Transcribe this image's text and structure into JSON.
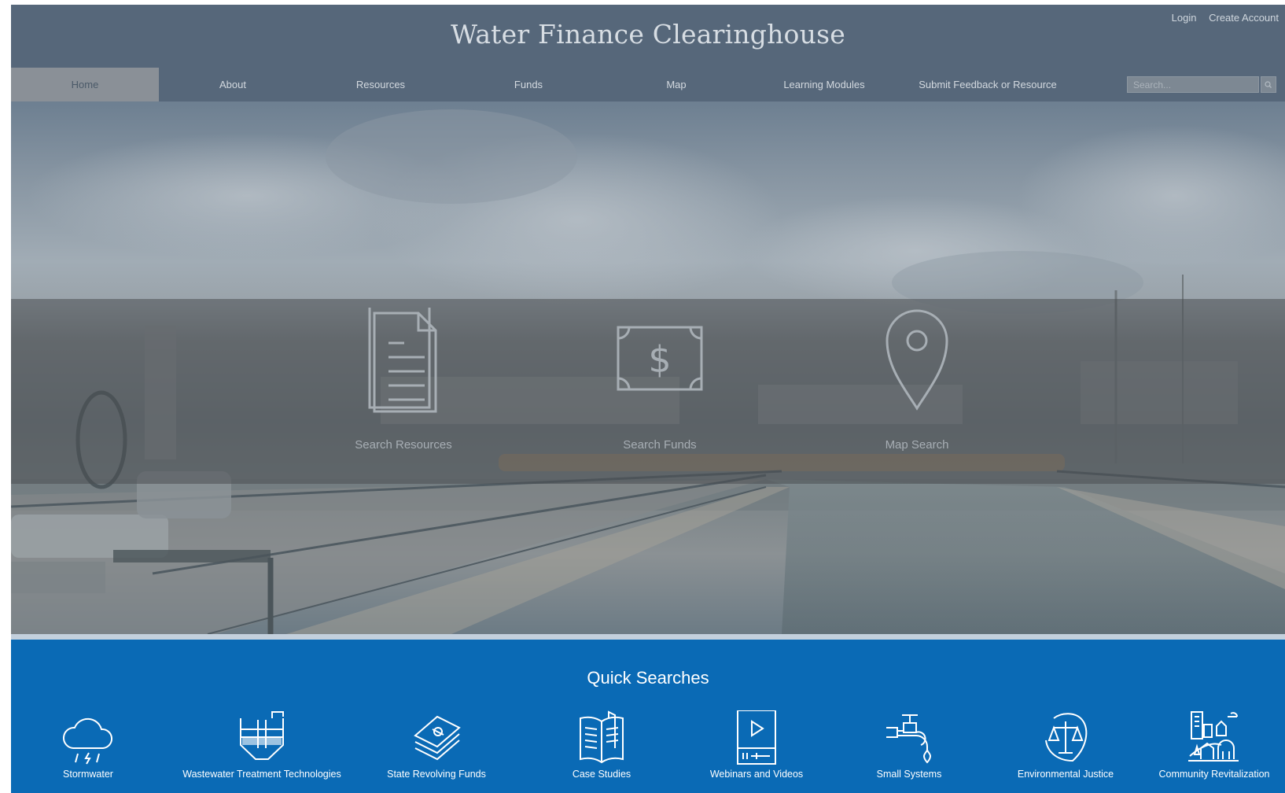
{
  "header": {
    "site_title": "Water Finance Clearinghouse",
    "login": "Login",
    "create_account": "Create Account"
  },
  "nav": {
    "items": [
      {
        "label": "Home",
        "active": true
      },
      {
        "label": "About"
      },
      {
        "label": "Resources"
      },
      {
        "label": "Funds"
      },
      {
        "label": "Map"
      },
      {
        "label": "Learning Modules"
      },
      {
        "label": "Submit Feedback or Resource"
      }
    ],
    "search_placeholder": "Search..."
  },
  "hero": {
    "tiles": [
      {
        "label": "Search Resources",
        "icon": "document-icon"
      },
      {
        "label": "Search Funds",
        "icon": "dollar-bill-icon"
      },
      {
        "label": "Map Search",
        "icon": "map-pin-icon"
      }
    ]
  },
  "quick_searches": {
    "title": "Quick Searches",
    "items": [
      {
        "label": "Stormwater",
        "icon": "rain-cloud-icon"
      },
      {
        "label": "Wastewater Treatment Technologies",
        "icon": "treatment-tank-icon"
      },
      {
        "label": "State Revolving Funds",
        "icon": "money-stack-icon"
      },
      {
        "label": "Case Studies",
        "icon": "open-book-icon"
      },
      {
        "label": "Webinars and Videos",
        "icon": "video-player-icon"
      },
      {
        "label": "Small Systems",
        "icon": "water-faucet-icon"
      },
      {
        "label": "Environmental Justice",
        "icon": "justice-scales-icon"
      },
      {
        "label": "Community Revitalization",
        "icon": "city-buildings-icon"
      }
    ]
  },
  "colors": {
    "header_bg": "#56677a",
    "quick_searches_bg": "#0a6ab5",
    "active_nav_bg": "#8a9097"
  }
}
